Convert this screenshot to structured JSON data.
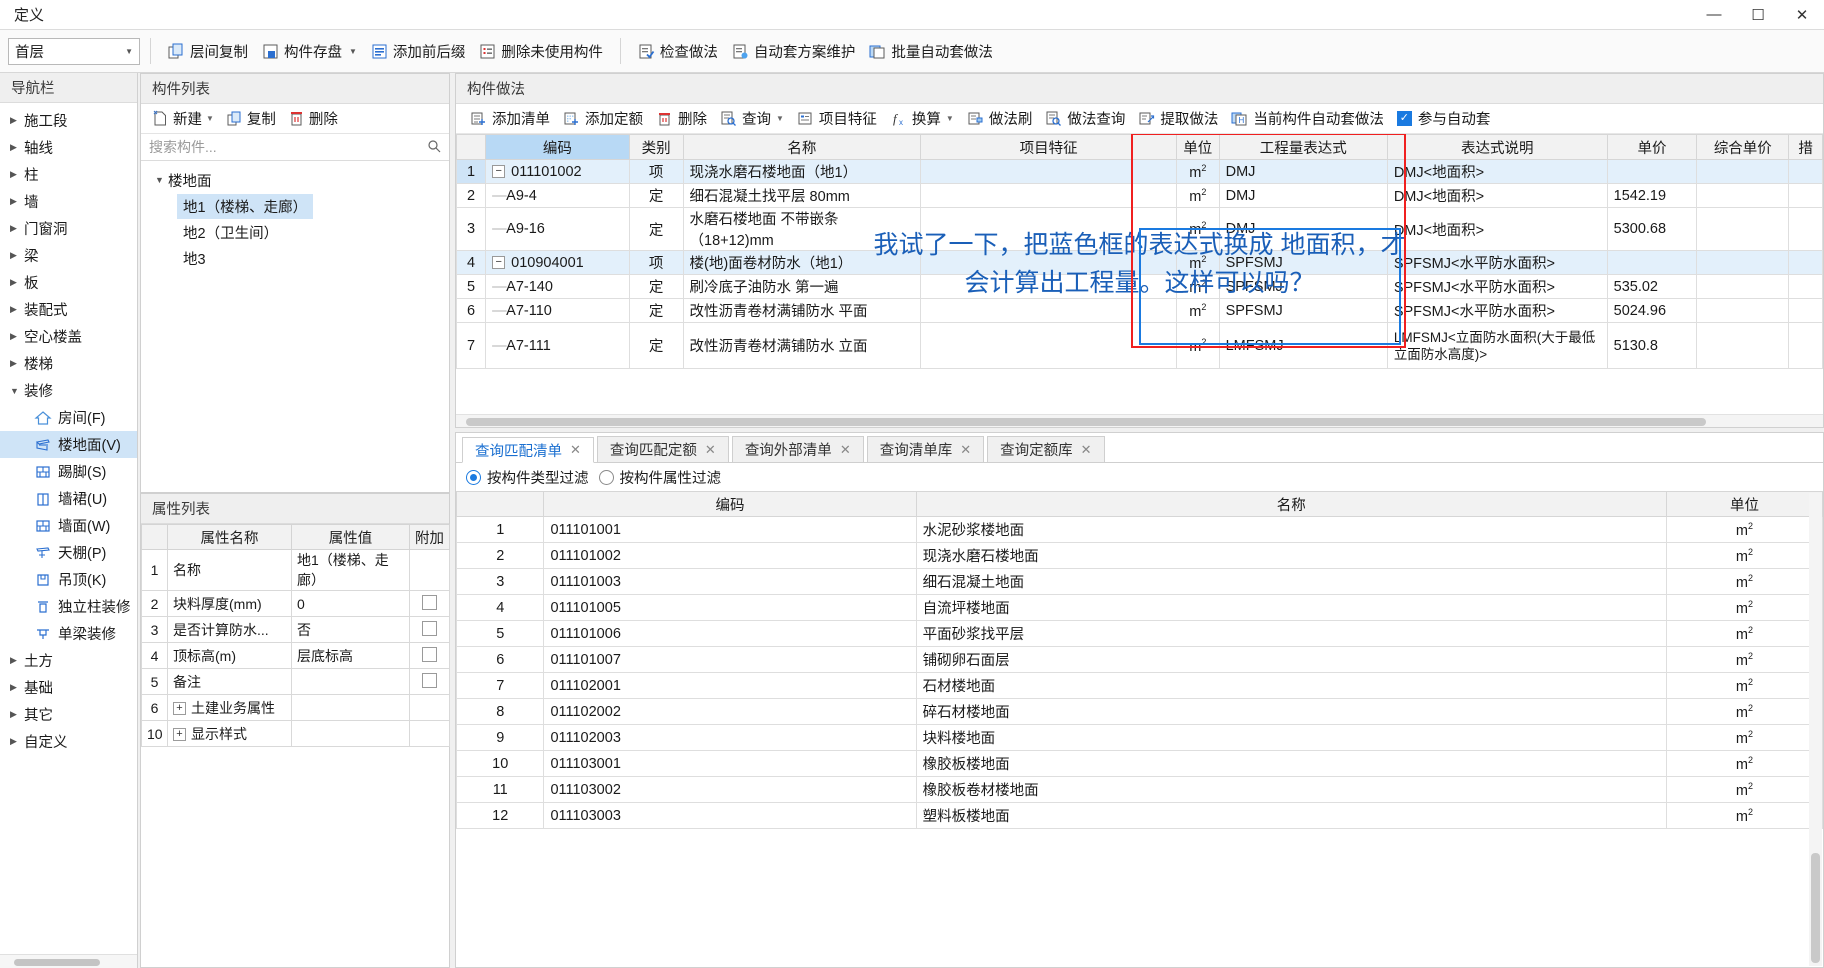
{
  "window": {
    "title": "定义",
    "minimize": "—",
    "maximize": "☐",
    "close": "✕"
  },
  "ribbon": {
    "floor": "首层",
    "buttons": [
      {
        "label": "层间复制",
        "icon": "copy-between-floors-icon",
        "dropdown": false
      },
      {
        "label": "构件存盘",
        "icon": "save-component-icon",
        "dropdown": true
      },
      {
        "label": "添加前后缀",
        "icon": "add-affix-icon",
        "dropdown": false
      },
      {
        "label": "删除未使用构件",
        "icon": "delete-unused-icon",
        "dropdown": false
      },
      {
        "label": "检查做法",
        "icon": "check-method-icon",
        "dropdown": false
      },
      {
        "label": "自动套方案维护",
        "icon": "auto-scheme-icon",
        "dropdown": false
      },
      {
        "label": "批量自动套做法",
        "icon": "batch-auto-icon",
        "dropdown": false
      }
    ]
  },
  "nav": {
    "title": "导航栏",
    "items": [
      {
        "label": "施工段",
        "expanded": false,
        "type": "group"
      },
      {
        "label": "轴线",
        "expanded": false,
        "type": "group"
      },
      {
        "label": "柱",
        "expanded": false,
        "type": "group"
      },
      {
        "label": "墙",
        "expanded": false,
        "type": "group"
      },
      {
        "label": "门窗洞",
        "expanded": false,
        "type": "group"
      },
      {
        "label": "梁",
        "expanded": false,
        "type": "group"
      },
      {
        "label": "板",
        "expanded": false,
        "type": "group"
      },
      {
        "label": "装配式",
        "expanded": false,
        "type": "group"
      },
      {
        "label": "空心楼盖",
        "expanded": false,
        "type": "group"
      },
      {
        "label": "楼梯",
        "expanded": false,
        "type": "group"
      },
      {
        "label": "装修",
        "expanded": true,
        "type": "group"
      },
      {
        "label": "房间(F)",
        "type": "child",
        "icon": "room-icon",
        "selected": false
      },
      {
        "label": "楼地面(V)",
        "type": "child",
        "icon": "floor-icon",
        "selected": true
      },
      {
        "label": "踢脚(S)",
        "type": "child",
        "icon": "skirting-icon",
        "selected": false
      },
      {
        "label": "墙裙(U)",
        "type": "child",
        "icon": "wainscot-icon",
        "selected": false
      },
      {
        "label": "墙面(W)",
        "type": "child",
        "icon": "wallface-icon",
        "selected": false
      },
      {
        "label": "天棚(P)",
        "type": "child",
        "icon": "ceiling-icon",
        "selected": false
      },
      {
        "label": "吊顶(K)",
        "type": "child",
        "icon": "suspended-ceiling-icon",
        "selected": false
      },
      {
        "label": "独立柱装修",
        "type": "child",
        "icon": "column-finish-icon",
        "selected": false
      },
      {
        "label": "单梁装修",
        "type": "child",
        "icon": "beam-finish-icon",
        "selected": false
      },
      {
        "label": "土方",
        "expanded": false,
        "type": "group"
      },
      {
        "label": "基础",
        "expanded": false,
        "type": "group"
      },
      {
        "label": "其它",
        "expanded": false,
        "type": "group"
      },
      {
        "label": "自定义",
        "expanded": false,
        "type": "group"
      }
    ]
  },
  "component_list": {
    "title": "构件列表",
    "tools": [
      {
        "label": "新建",
        "icon": "new-icon",
        "dropdown": true
      },
      {
        "label": "复制",
        "icon": "copy-icon",
        "dropdown": false
      },
      {
        "label": "删除",
        "icon": "delete-icon",
        "dropdown": false
      }
    ],
    "search_placeholder": "搜索构件...",
    "tree_root": "楼地面",
    "tree_items": [
      {
        "label": "地1（楼梯、走廊）",
        "selected": true
      },
      {
        "label": "地2（卫生间）",
        "selected": false
      },
      {
        "label": "地3",
        "selected": false
      }
    ]
  },
  "property_list": {
    "title": "属性列表",
    "columns": [
      "",
      "属性名称",
      "属性值",
      "附加"
    ],
    "rows": [
      {
        "no": "1",
        "name": "名称",
        "value": "地1（楼梯、走廊）",
        "link": true,
        "check": false,
        "expandable": false
      },
      {
        "no": "2",
        "name": "块料厚度(mm)",
        "value": "0",
        "link": true,
        "check": true,
        "expandable": false
      },
      {
        "no": "3",
        "name": "是否计算防水...",
        "value": "否",
        "link": false,
        "check": true,
        "expandable": false
      },
      {
        "no": "4",
        "name": "顶标高(m)",
        "value": "层底标高",
        "link": false,
        "check": true,
        "expandable": false
      },
      {
        "no": "5",
        "name": "备注",
        "value": "",
        "link": false,
        "check": true,
        "expandable": false
      },
      {
        "no": "6",
        "name": "土建业务属性",
        "value": "",
        "link": false,
        "check": false,
        "expandable": true
      },
      {
        "no": "10",
        "name": "显示样式",
        "value": "",
        "link": false,
        "check": false,
        "expandable": true
      }
    ]
  },
  "zuofa": {
    "title": "构件做法",
    "tools": [
      {
        "label": "添加清单",
        "icon": "add-list-icon",
        "dropdown": false
      },
      {
        "label": "添加定额",
        "icon": "add-quota-icon",
        "dropdown": false
      },
      {
        "label": "删除",
        "icon": "delete-icon",
        "dropdown": false
      },
      {
        "label": "查询",
        "icon": "query-icon",
        "dropdown": true
      },
      {
        "label": "项目特征",
        "icon": "feature-icon",
        "dropdown": false
      },
      {
        "label": "换算",
        "icon": "convert-icon",
        "dropdown": true
      },
      {
        "label": "做法刷",
        "icon": "method-brush-icon",
        "dropdown": false
      },
      {
        "label": "做法查询",
        "icon": "method-query-icon",
        "dropdown": false
      },
      {
        "label": "提取做法",
        "icon": "extract-method-icon",
        "dropdown": false
      },
      {
        "label": "当前构件自动套做法",
        "icon": "auto-apply-icon",
        "dropdown": false
      }
    ],
    "checkbox_label": "参与自动套",
    "checkbox_checked": true,
    "columns": [
      "",
      "编码",
      "类别",
      "名称",
      "项目特征",
      "单位",
      "工程量表达式",
      "表达式说明",
      "单价",
      "综合单价",
      "措"
    ],
    "selected_column": "编码",
    "rows": [
      {
        "no": "1",
        "code": "011101002",
        "cat": "项",
        "name": "现浇水磨石楼地面（地1）",
        "feature": "",
        "unit": "m²",
        "expr": "DMJ",
        "desc": "DMJ<地面积>",
        "price": "",
        "cprice": "",
        "parent": true,
        "highlight": true,
        "current": true
      },
      {
        "no": "2",
        "code": "A9-4",
        "cat": "定",
        "name": "细石混凝土找平层 80mm",
        "feature": "",
        "unit": "m²",
        "expr": "DMJ",
        "desc": "DMJ<地面积>",
        "price": "1542.19",
        "cprice": "",
        "parent": false,
        "highlight": false,
        "current": false
      },
      {
        "no": "3",
        "code": "A9-16",
        "cat": "定",
        "name": "水磨石楼地面 不带嵌条（18+12)mm",
        "feature": "",
        "unit": "m²",
        "expr": "DMJ",
        "desc": "DMJ<地面积>",
        "price": "5300.68",
        "cprice": "",
        "parent": false,
        "highlight": false,
        "current": false
      },
      {
        "no": "4",
        "code": "010904001",
        "cat": "项",
        "name": "楼(地)面卷材防水（地1）",
        "feature": "",
        "unit": "m²",
        "expr": "SPFSMJ",
        "desc": "SPFSMJ<水平防水面积>",
        "price": "",
        "cprice": "",
        "parent": true,
        "highlight": true,
        "current": false
      },
      {
        "no": "5",
        "code": "A7-140",
        "cat": "定",
        "name": "刷冷底子油防水 第一遍",
        "feature": "",
        "unit": "m²",
        "expr": "SPFSMJ",
        "desc": "SPFSMJ<水平防水面积>",
        "price": "535.02",
        "cprice": "",
        "parent": false,
        "highlight": false,
        "current": false
      },
      {
        "no": "6",
        "code": "A7-110",
        "cat": "定",
        "name": "改性沥青卷材满铺防水 平面",
        "feature": "",
        "unit": "m²",
        "expr": "SPFSMJ",
        "desc": "SPFSMJ<水平防水面积>",
        "price": "5024.96",
        "cprice": "",
        "parent": false,
        "highlight": false,
        "current": false
      },
      {
        "no": "7",
        "code": "A7-111",
        "cat": "定",
        "name": "改性沥青卷材满铺防水 立面",
        "feature": "",
        "unit": "m²",
        "expr": "LMFSMJ",
        "desc": "LMFSMJ<立面防水面积(大于最低立面防水高度)>",
        "price": "5130.8",
        "cprice": "",
        "parent": false,
        "highlight": false,
        "current": false
      }
    ],
    "annotation": {
      "line1": "我试了一下，把蓝色框的表达式换成 地面积，才",
      "line2": "会计算出工程量。这样可以吗？",
      "color": "#1a5fb8"
    },
    "highlight_boxes": {
      "red_color": "#f02020",
      "blue_color": "#1a7ae0"
    }
  },
  "query_panel": {
    "tabs": [
      {
        "label": "查询匹配清单",
        "active": true
      },
      {
        "label": "查询匹配定额",
        "active": false
      },
      {
        "label": "查询外部清单",
        "active": false
      },
      {
        "label": "查询清单库",
        "active": false
      },
      {
        "label": "查询定额库",
        "active": false
      }
    ],
    "filters": [
      {
        "label": "按构件类型过滤",
        "checked": true
      },
      {
        "label": "按构件属性过滤",
        "checked": false
      }
    ],
    "columns": [
      "",
      "编码",
      "名称",
      "单位"
    ],
    "rows": [
      {
        "no": "1",
        "code": "011101001",
        "name": "水泥砂浆楼地面",
        "unit": "m²"
      },
      {
        "no": "2",
        "code": "011101002",
        "name": "现浇水磨石楼地面",
        "unit": "m²"
      },
      {
        "no": "3",
        "code": "011101003",
        "name": "细石混凝土地面",
        "unit": "m²"
      },
      {
        "no": "4",
        "code": "011101005",
        "name": "自流坪楼地面",
        "unit": "m²"
      },
      {
        "no": "5",
        "code": "011101006",
        "name": "平面砂浆找平层",
        "unit": "m²"
      },
      {
        "no": "6",
        "code": "011101007",
        "name": "铺砌卵石面层",
        "unit": "m²"
      },
      {
        "no": "7",
        "code": "011102001",
        "name": "石材楼地面",
        "unit": "m²"
      },
      {
        "no": "8",
        "code": "011102002",
        "name": "碎石材楼地面",
        "unit": "m²"
      },
      {
        "no": "9",
        "code": "011102003",
        "name": "块料楼地面",
        "unit": "m²"
      },
      {
        "no": "10",
        "code": "011103001",
        "name": "橡胶板楼地面",
        "unit": "m²"
      },
      {
        "no": "11",
        "code": "011103002",
        "name": "橡胶板卷材楼地面",
        "unit": "m²"
      },
      {
        "no": "12",
        "code": "011103003",
        "name": "塑料板楼地面",
        "unit": "m²"
      }
    ]
  }
}
